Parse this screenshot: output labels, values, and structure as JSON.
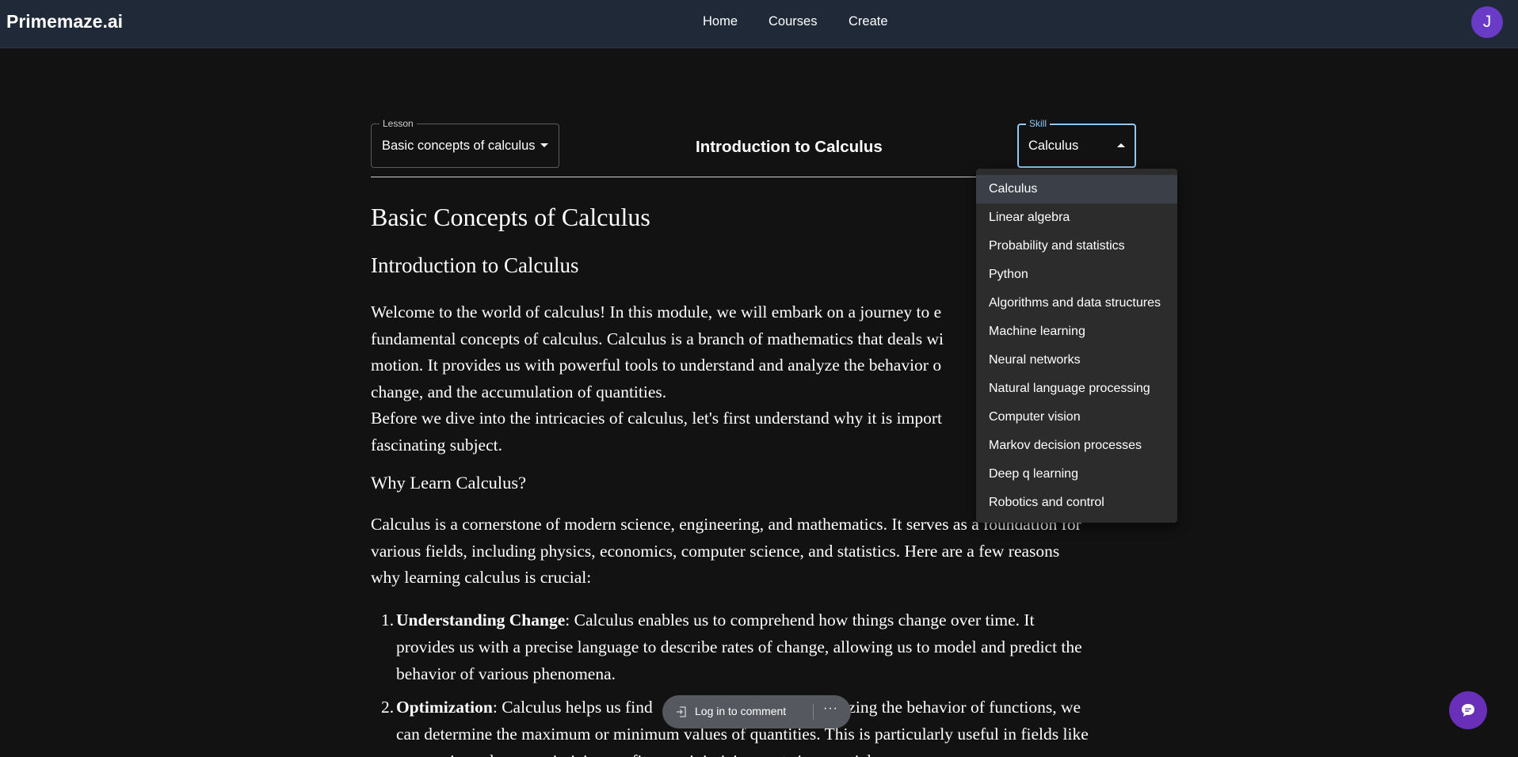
{
  "header": {
    "brand": "Primemaze.ai",
    "nav": [
      "Home",
      "Courses",
      "Create"
    ],
    "avatar_initial": "J"
  },
  "controls": {
    "lesson_label": "Lesson",
    "lesson_value": "Basic concepts of calculus",
    "title": "Introduction to Calculus",
    "skill_label": "Skill",
    "skill_value": "Calculus"
  },
  "skill_menu": {
    "items": [
      "Calculus",
      "Linear algebra",
      "Probability and statistics",
      "Python",
      "Algorithms and data structures",
      "Machine learning",
      "Neural networks",
      "Natural language processing",
      "Computer vision",
      "Markov decision processes",
      "Deep q learning",
      "Robotics and control"
    ],
    "selected_index": 0
  },
  "content": {
    "h1": "Basic Concepts of Calculus",
    "h2": "Introduction to Calculus",
    "p1_lines": [
      "Welcome to the world of calculus! In this module, we will embark on a journey to e",
      "fundamental concepts of calculus. Calculus is a branch of mathematics that deals wi",
      "motion. It provides us with powerful tools to understand and analyze the behavior o",
      "change, and the accumulation of quantities.",
      "Before we dive into the intricacies of calculus, let's first understand why it is import",
      "fascinating subject."
    ],
    "h3": "Why Learn Calculus?",
    "p2_lines": [
      "Calculus is a cornerstone of modern science, engineering, and mathematics. It serves as a foundation for",
      "various fields, including physics, economics, computer science, and statistics. Here are a few reasons",
      "why learning calculus is crucial:"
    ],
    "list": [
      {
        "num": "1.",
        "term": "Understanding Change",
        "lines": [
          ": Calculus enables us to comprehend how things change over time. It",
          "provides us with a precise language to describe rates of change, allowing us to model and predict the",
          "behavior of various phenomena."
        ]
      },
      {
        "num": "2.",
        "term": "Optimization",
        "lines": [
          ": Calculus helps us find                                         alyzing the behavior of functions, we",
          "can determine the maximum or minimum values of quantities. This is particularly useful in fields like",
          "economics, where maximizing profits or minimizing costs is essential."
        ]
      }
    ]
  },
  "comment_bar": {
    "label": "Log in to comment",
    "more": "···"
  }
}
